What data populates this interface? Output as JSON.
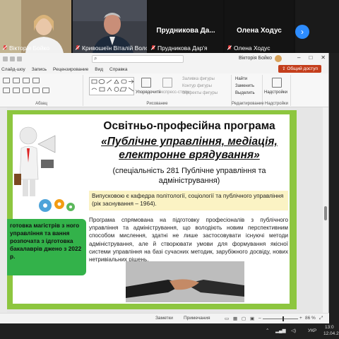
{
  "participants": [
    {
      "name": "Вікторія Бойко",
      "muted": true
    },
    {
      "name": "Кривошеїн Віталій Воло...",
      "muted": true
    },
    {
      "name": "Прудникова Дар'я",
      "muted": true
    },
    {
      "name": "Олена Ходус",
      "muted": true
    }
  ],
  "tiles_named": [
    {
      "title": "Прудникова Да..."
    },
    {
      "title": "Олена Ходус"
    }
  ],
  "ppt": {
    "user": "Вікторія Бойко",
    "menu": [
      "Слайд-шоу",
      "Запись",
      "Рецензирование",
      "Вид",
      "Справка"
    ],
    "share_label": "Общий доступ",
    "ribbon": {
      "group_labels": [
        "Абзац",
        "Рисование",
        "Редактирование",
        "Надстройки"
      ],
      "arrange": "Упорядочить",
      "express": "Экспресс-стили",
      "fill": "Заливка фигуры",
      "outline": "Контур фигуры",
      "effects": "Эффекты фигуры",
      "find": "Найти",
      "replace": "Заменить",
      "select": "Выделить",
      "addins": "Надстройки"
    },
    "statusbar": {
      "notes": "Заметки",
      "comments": "Примечания",
      "zoom": "86 %"
    }
  },
  "slide": {
    "title_line1": "Освітньо-професійна програма",
    "title_line2": "«Публічне управління, медіація, електронне врядування»",
    "subtitle": "(спеціальність 281 Публічне управління та адміністрування)",
    "dept_box": "Випусковою є кафедра політології, соціології та публічного управління (рік заснування – 1964).",
    "body": "Програма спрямована на підготовку професіоналів з публічного управління та адміністрування, що володіють новим перспективним способом мислення, здатні не лише застосовувати існуючі методи адміністрування, але й створювати умови для формування якісної системи управління на базі сучасних методик, зарубіжного досвіду, нових нетривіальних рішень.",
    "green_box": "готовка магістрів з ного управління та вання розпочата з ідготовка бакалаврів джено з 2022 р."
  },
  "taskbar": {
    "lang": "УКР",
    "time": "13:0",
    "date": "12.04.2"
  },
  "colors": {
    "slide_border": "#8dc63f",
    "share_button": "#c43e1c",
    "zoom_blue": "#2d8cff",
    "green_box": "#33b24a",
    "dept_box": "#fbf3c4"
  }
}
